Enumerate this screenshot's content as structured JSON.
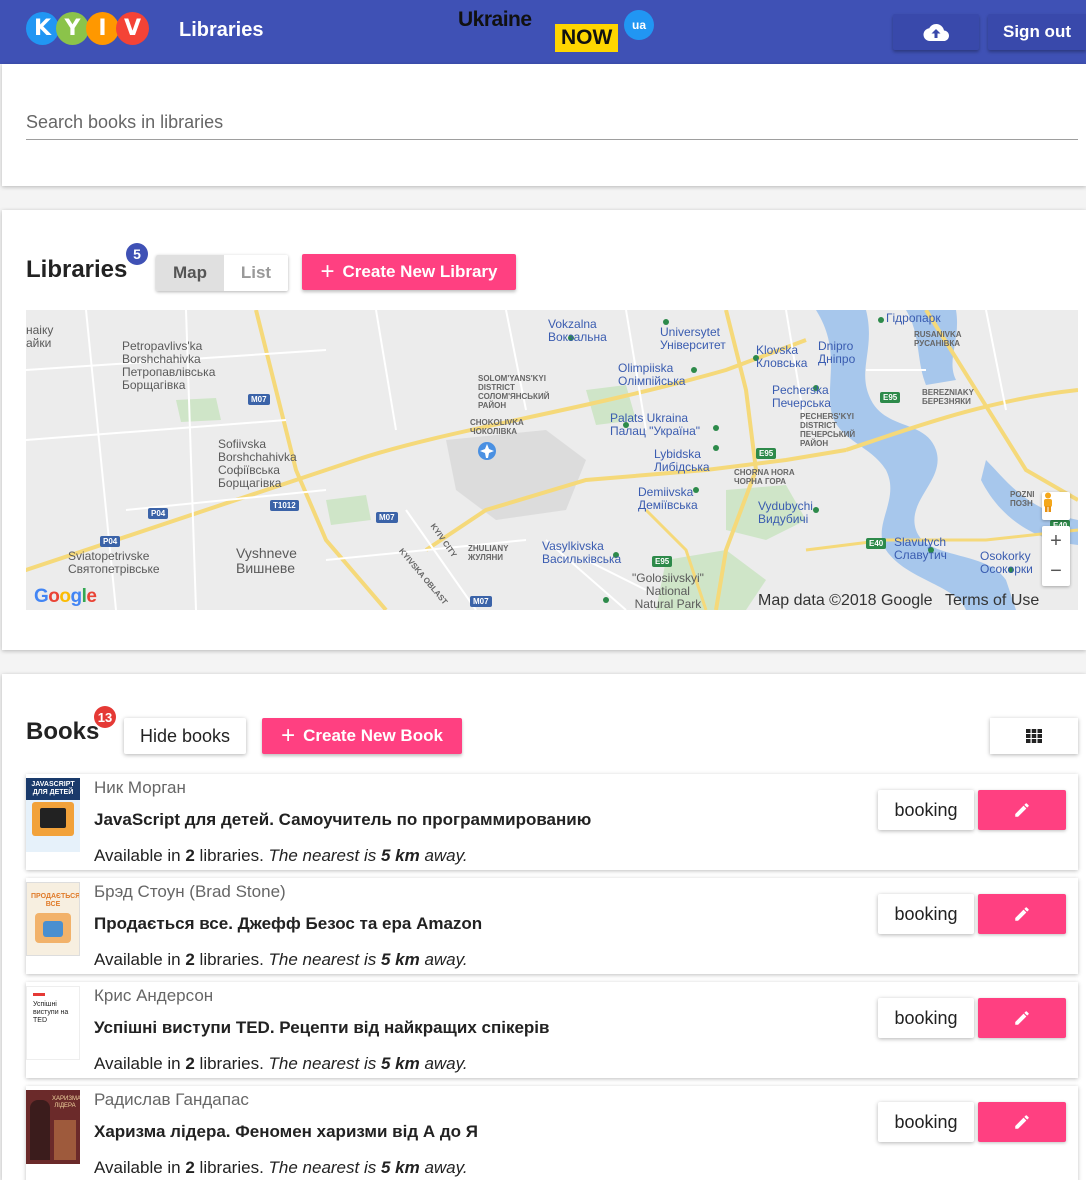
{
  "header": {
    "logo_letters": [
      "K",
      "Y",
      "I",
      "V"
    ],
    "logo_colors": [
      "#2196f3",
      "#8bc34a",
      "#ff9800",
      "#f44336"
    ],
    "app_title": "Libraries",
    "ukraine_now": {
      "word": "Ukraine",
      "now": "NOW",
      "ua": "ua"
    },
    "upload_icon": "cloud-upload-icon",
    "sign_out_label": "Sign out"
  },
  "search": {
    "placeholder": "Search books in libraries",
    "value": ""
  },
  "libraries": {
    "title": "Libraries",
    "count": "5",
    "badge_color": "#3f51b5",
    "view_map_label": "Map",
    "view_list_label": "List",
    "view_selected": "Map",
    "create_label": "Create New Library",
    "map": {
      "labels": {
        "vokzalna": "Vokzalna",
        "vokzalna_ua": "Вокзальна",
        "universytet": "Universytet",
        "universytet_ua": "Університет",
        "hidropark": "Гідропарк",
        "rusanivka": "RUSANIVKA",
        "rusanivka_ua": "РУСАНІВКА",
        "naiky": "наіку",
        "naiky_ua": "айки",
        "petro": "Petropavlivs'ka",
        "petro2": "Borshchahivka",
        "petro_ua": "Петропавлівська",
        "petro_ua2": "Борщагівка",
        "klovska": "Klovska",
        "klovska_ua": "Кловська",
        "dnipro": "Dnipro",
        "dnipro_ua": "Дніпро",
        "olimp": "Olimpiiska",
        "olimp_ua": "Олімпійська",
        "solom": "SOLOM'YANS'KYI",
        "solom2": "DISTRICT",
        "solom_ua": "СОЛОМ'ЯНСЬКИЙ",
        "solom_ua2": "РАЙОН",
        "pechersk": "Pecherska",
        "pechersk_ua": "Печерська",
        "berez": "BEREZNIAKY",
        "berez_ua": "БЕРЕЗНЯКИ",
        "chok": "CHOKOLIVKA",
        "chok_ua": "ЧОКОЛІВКА",
        "palats": "Palats Ukraina",
        "palats_ua": "Палац \"Україна\"",
        "pech_d": "PECHERS'KYI",
        "pech_d2": "DISTRICT",
        "pech_d_ua": "ПЕЧЕРСЬКИЙ",
        "pech_d_ua2": "РАЙОН",
        "sofi": "Sofiivska",
        "sofi2": "Borshchahivka",
        "sofi_ua": "Софіївська",
        "sofi_ua2": "Борщагівка",
        "lyb": "Lybidska",
        "lyb_ua": "Либідська",
        "chorna": "CHORNA HORA",
        "chorna_ua": "ЧОРНА ГОРА",
        "dem": "Demiivska",
        "dem_ua": "Деміївська",
        "vyd": "Vydubychi",
        "vyd_ua": "Видубичі",
        "pozn": "POZNI",
        "pozn_ua": "ПОЗН",
        "sviato": "Sviatopetrivske",
        "sviato_ua": "Святопетрівське",
        "vysh": "Vyshneve",
        "vysh_ua": "Вишневе",
        "kyivcity": "KYIV CITY",
        "zhul": "ZHULIANY",
        "zhul_ua": "ЖУЛЯНИ",
        "vasyl": "Vasylkivska",
        "vasyl_ua": "Васильківська",
        "slav": "Slavutych",
        "slav_ua": "Славутич",
        "osok": "Osokorky",
        "osok_ua": "Осокорки",
        "golos": "\"Golosiivskyi\"",
        "golos2": "National",
        "golos3": "Natural Park",
        "kyivska": "KYIVSKA OBLAST"
      },
      "roads": {
        "m07a": "M07",
        "m07b": "M07",
        "m07c": "M07",
        "p04a": "P04",
        "p04b": "P04",
        "t1012": "T1012",
        "e95a": "E95",
        "e95b": "E95",
        "e95c": "E95",
        "e40a": "E40",
        "e40b": "E40"
      },
      "google_logo": "Google",
      "footer_data": "Map data ©2018 Google",
      "footer_terms": "Terms of Use",
      "zoom_in": "+",
      "zoom_out": "−",
      "pegman_icon": "pegman-icon",
      "airport_icon": "airport-icon"
    }
  },
  "books": {
    "title": "Books",
    "count": "13",
    "badge_color": "#e53935",
    "hide_label": "Hide books",
    "create_label": "Create New Book",
    "grid_icon": "grid-view-icon",
    "items": [
      {
        "author": "Ник Морган",
        "title": "JavaScript для детей. Самоучитель по программированию",
        "available_prefix": "Available in ",
        "libraries_count": "2",
        "libraries_word": " libraries.",
        "nearest_prefix": " The nearest is ",
        "distance": "5 km",
        "nearest_suffix": " away.",
        "booking_label": "booking",
        "cover_text": "JAVASCRIPT ДЛЯ ДЕТЕЙ"
      },
      {
        "author": "Брэд Стоун (Brad Stone)",
        "title": "Продається все. Джефф Безос та ера Amazon",
        "available_prefix": "Available in ",
        "libraries_count": "2",
        "libraries_word": " libraries.",
        "nearest_prefix": " The nearest is ",
        "distance": "5 km",
        "nearest_suffix": " away.",
        "booking_label": "booking",
        "cover_text": "ПРОДАЄТЬСЯ ВСЕ"
      },
      {
        "author": "Крис Андерсон",
        "title": "Успішні виступи TED. Рецепти від найкращих спікерів",
        "available_prefix": "Available in ",
        "libraries_count": "2",
        "libraries_word": " libraries.",
        "nearest_prefix": " The nearest is ",
        "distance": "5 km",
        "nearest_suffix": " away.",
        "booking_label": "booking",
        "cover_text": "Успішні виступи на TED"
      },
      {
        "author": "Радислав Гандапас",
        "title": "Харизма лідера. Феномен харизми від А до Я",
        "available_prefix": "Available in ",
        "libraries_count": "2",
        "libraries_word": " libraries.",
        "nearest_prefix": " The nearest is ",
        "distance": "5 km",
        "nearest_suffix": " away.",
        "booking_label": "booking",
        "cover_text": "ХАРИЗМА ЛІДЕРА"
      }
    ]
  },
  "colors": {
    "primary": "#3f51b5",
    "accent": "#ff4081"
  }
}
